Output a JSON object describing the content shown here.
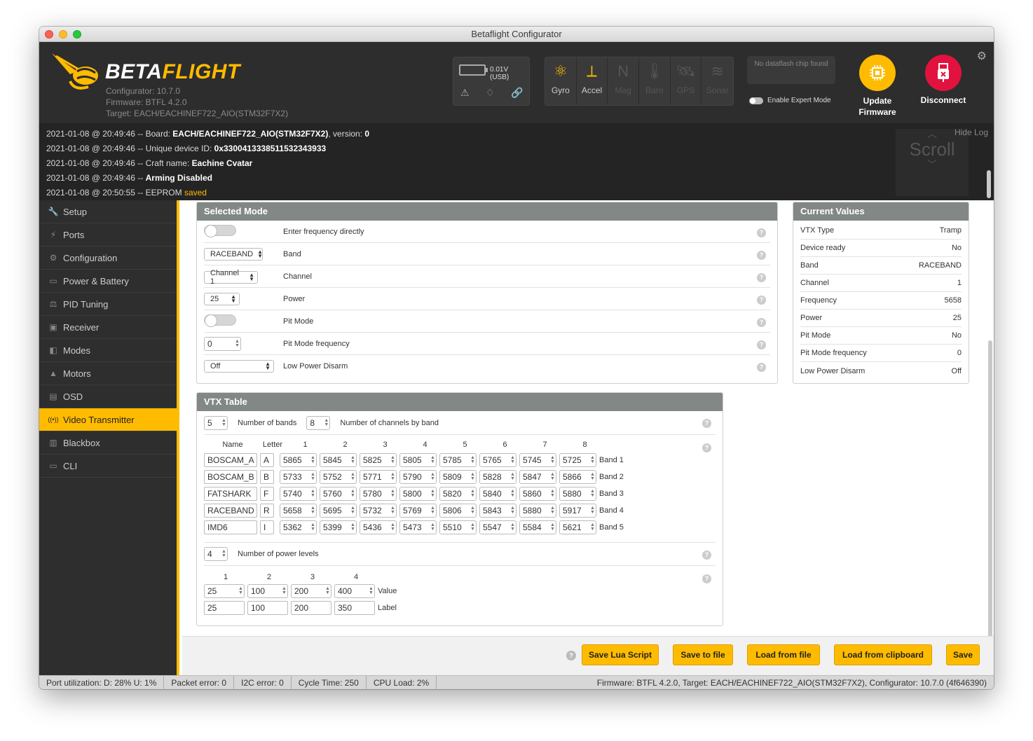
{
  "window": {
    "title": "Betaflight Configurator"
  },
  "header": {
    "logo_beta": "BETA",
    "logo_flight": "FLIGHT",
    "configurator": "Configurator: 10.7.0",
    "firmware": "Firmware: BTFL 4.2.0",
    "target": "Target: EACH/EACHINEF722_AIO(STM32F7X2)",
    "battery": "0.01V (USB)",
    "sensors": [
      {
        "label": "Gyro",
        "icon": "gyro-icon",
        "active": true
      },
      {
        "label": "Accel",
        "icon": "accel-icon",
        "active": true
      },
      {
        "label": "Mag",
        "icon": "mag-icon",
        "active": false
      },
      {
        "label": "Baro",
        "icon": "baro-icon",
        "active": false
      },
      {
        "label": "GPS",
        "icon": "gps-icon",
        "active": false
      },
      {
        "label": "Sonar",
        "icon": "sonar-icon",
        "active": false
      }
    ],
    "dataflash": "No dataflash chip found",
    "expert_mode": "Enable Expert Mode",
    "update_firmware": "Update Firmware",
    "disconnect": "Disconnect"
  },
  "log": {
    "lines": [
      {
        "prefix": "2021-01-08 @ 20:49:46 -- Board: ",
        "bold": "EACH/EACHINEF722_AIO(STM32F7X2)",
        "suffix": ", version: ",
        "bold2": "0"
      },
      {
        "prefix": "2021-01-08 @ 20:49:46 -- Unique device ID: ",
        "bold": "0x3300413338511532343933",
        "suffix": "",
        "bold2": ""
      },
      {
        "prefix": "2021-01-08 @ 20:49:46 -- Craft name: ",
        "bold": "Eachine Cvatar",
        "suffix": "",
        "bold2": ""
      },
      {
        "prefix": "2021-01-08 @ 20:49:46 -- ",
        "bold": "Arming Disabled",
        "suffix": "",
        "bold2": ""
      },
      {
        "prefix": "2021-01-08 @ 20:50:55 -- EEPROM ",
        "bold": "",
        "suffix": "",
        "bold2": "",
        "saved": "saved"
      }
    ],
    "hide_log": "Hide Log",
    "scroll": "Scroll"
  },
  "sidebar": {
    "items": [
      {
        "label": "Setup",
        "icon": "wrench-icon",
        "glyph": "🔧"
      },
      {
        "label": "Ports",
        "icon": "plug-icon",
        "glyph": "⚡"
      },
      {
        "label": "Configuration",
        "icon": "gear-icon",
        "glyph": "⚙"
      },
      {
        "label": "Power & Battery",
        "icon": "battery-icon",
        "glyph": "▭"
      },
      {
        "label": "PID Tuning",
        "icon": "pid-icon",
        "glyph": "⚖"
      },
      {
        "label": "Receiver",
        "icon": "receiver-icon",
        "glyph": "▣"
      },
      {
        "label": "Modes",
        "icon": "modes-icon",
        "glyph": "◧"
      },
      {
        "label": "Motors",
        "icon": "motor-icon",
        "glyph": "▲"
      },
      {
        "label": "OSD",
        "icon": "osd-icon",
        "glyph": "▤"
      },
      {
        "label": "Video Transmitter",
        "icon": "vtx-icon",
        "glyph": "((•))",
        "active": true
      },
      {
        "label": "Blackbox",
        "icon": "blackbox-icon",
        "glyph": "▥"
      },
      {
        "label": "CLI",
        "icon": "cli-icon",
        "glyph": "▭"
      }
    ]
  },
  "selected_mode": {
    "title": "Selected Mode",
    "rows": {
      "enter_freq": "Enter frequency directly",
      "band_value": "RACEBAND",
      "band_label": "Band",
      "channel_value": "Channel 1",
      "channel_label": "Channel",
      "power_value": "25",
      "power_label": "Power",
      "pit_mode": "Pit Mode",
      "pit_freq_value": "0",
      "pit_freq_label": "Pit Mode frequency",
      "lpd_value": "Off",
      "lpd_label": "Low Power Disarm"
    }
  },
  "current_values": {
    "title": "Current Values",
    "rows": [
      {
        "k": "VTX Type",
        "v": "Tramp"
      },
      {
        "k": "Device ready",
        "v": "No"
      },
      {
        "k": "Band",
        "v": "RACEBAND"
      },
      {
        "k": "Channel",
        "v": "1"
      },
      {
        "k": "Frequency",
        "v": "5658"
      },
      {
        "k": "Power",
        "v": "25"
      },
      {
        "k": "Pit Mode",
        "v": "No"
      },
      {
        "k": "Pit Mode frequency",
        "v": "0"
      },
      {
        "k": "Low Power Disarm",
        "v": "Off"
      }
    ]
  },
  "vtx_table": {
    "title": "VTX Table",
    "num_bands": "5",
    "num_bands_label": "Number of bands",
    "num_channels": "8",
    "num_channels_label": "Number of channels by band",
    "col_name": "Name",
    "col_letter": "Letter",
    "channel_headers": [
      "1",
      "2",
      "3",
      "4",
      "5",
      "6",
      "7",
      "8"
    ],
    "bands": [
      {
        "name": "BOSCAM_A",
        "letter": "A",
        "freqs": [
          "5865",
          "5845",
          "5825",
          "5805",
          "5785",
          "5765",
          "5745",
          "5725"
        ],
        "label": "Band 1"
      },
      {
        "name": "BOSCAM_B",
        "letter": "B",
        "freqs": [
          "5733",
          "5752",
          "5771",
          "5790",
          "5809",
          "5828",
          "5847",
          "5866"
        ],
        "label": "Band 2"
      },
      {
        "name": "FATSHARK",
        "letter": "F",
        "freqs": [
          "5740",
          "5760",
          "5780",
          "5800",
          "5820",
          "5840",
          "5860",
          "5880"
        ],
        "label": "Band 3"
      },
      {
        "name": "RACEBAND",
        "letter": "R",
        "freqs": [
          "5658",
          "5695",
          "5732",
          "5769",
          "5806",
          "5843",
          "5880",
          "5917"
        ],
        "label": "Band 4"
      },
      {
        "name": "IMD6",
        "letter": "I",
        "freqs": [
          "5362",
          "5399",
          "5436",
          "5473",
          "5510",
          "5547",
          "5584",
          "5621"
        ],
        "label": "Band 5"
      }
    ],
    "num_power": "4",
    "num_power_label": "Number of power levels",
    "power_headers": [
      "1",
      "2",
      "3",
      "4"
    ],
    "power_values": [
      "25",
      "100",
      "200",
      "400"
    ],
    "power_values_label": "Value",
    "power_labels": [
      "25",
      "100",
      "200",
      "350"
    ],
    "power_labels_label": "Label"
  },
  "footer": {
    "save_lua": "Save Lua Script",
    "save_file": "Save to file",
    "load_file": "Load from file",
    "load_clipboard": "Load from clipboard",
    "save": "Save"
  },
  "status": {
    "port_util": "Port utilization: D: 28% U: 1%",
    "packet_error": "Packet error: 0",
    "i2c_error": "I2C error: 0",
    "cycle_time": "Cycle Time: 250",
    "cpu_load": "CPU Load: 2%",
    "firmware_info": "Firmware: BTFL 4.2.0, Target: EACH/EACHINEF722_AIO(STM32F7X2), Configurator: 10.7.0 (4f646390)"
  },
  "colors": {
    "accent": "#ffbb00",
    "header_bg": "#2d2d2d",
    "disconnect": "#e2123f"
  }
}
